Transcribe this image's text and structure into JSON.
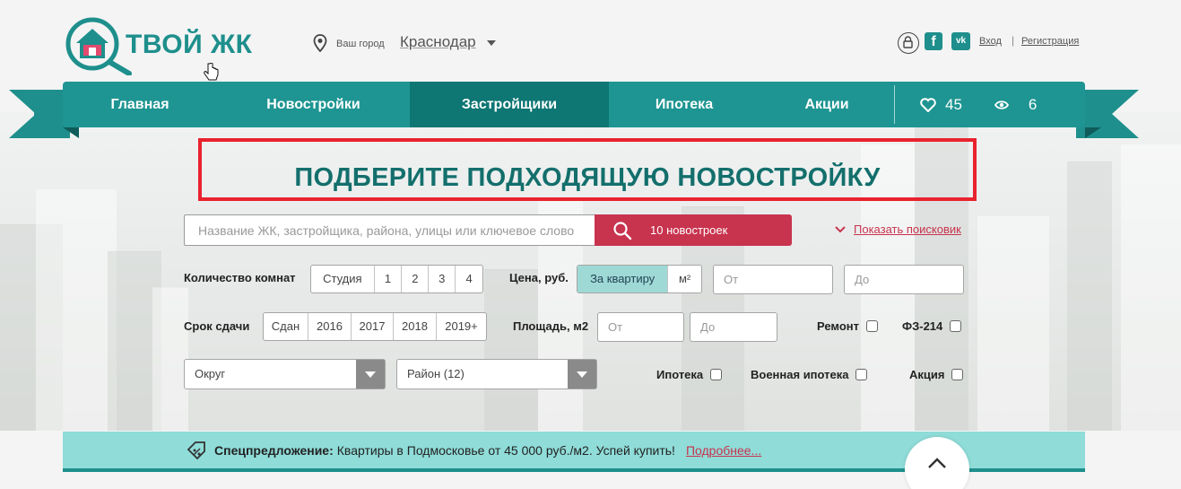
{
  "header": {
    "logo_text": "ТВОЙ ЖК",
    "city_label": "Ваш город",
    "city_name": "Краснодар",
    "login": "Вход",
    "separator": "|",
    "register": "Регистрация",
    "social": {
      "fb": "f",
      "vk": "vk"
    }
  },
  "nav": {
    "items": [
      "Главная",
      "Новостройки",
      "Застройщики",
      "Ипотека",
      "Акции"
    ],
    "active_index": 2,
    "favorites_count": "45",
    "views_count": "6"
  },
  "hero": {
    "title": "ПОДБЕРИТЕ ПОДХОДЯЩУЮ НОВОСТРОЙКУ"
  },
  "search": {
    "placeholder": "Название ЖК, застройщика, района, улицы или ключевое слово",
    "button_label": "10 новостроек",
    "toggle_label": "Показать поисковик"
  },
  "filters": {
    "rooms_label": "Количество комнат",
    "rooms": [
      "Студия",
      "1",
      "2",
      "3",
      "4"
    ],
    "price_label": "Цена, руб.",
    "price_mode": [
      "За квартиру",
      "м²"
    ],
    "price_from_placeholder": "От",
    "price_to_placeholder": "До",
    "deadline_label": "Срок сдачи",
    "deadlines": [
      "Сдан",
      "2016",
      "2017",
      "2018",
      "2019+"
    ],
    "area_label": "Площадь, м2",
    "area_from_placeholder": "От",
    "area_to_placeholder": "До",
    "repair_label": "Ремонт",
    "fz_label": "ФЗ-214",
    "okrug_select": "Округ",
    "rayon_select": "Район (12)",
    "mortgage_label": "Ипотека",
    "military_label": "Военная ипотека",
    "promo_label": "Акция"
  },
  "promo": {
    "strong": "Спецпредложение:",
    "text": "Квартиры в Подмосковье от 45 000 руб./м2. Успей купить!",
    "link": "Подробнее..."
  },
  "colors": {
    "teal": "#1e9592",
    "teal_dark": "#0e7673",
    "accent_red": "#c8334e",
    "frame_red": "#e8232e",
    "promo_bg": "#8fdcd8"
  }
}
